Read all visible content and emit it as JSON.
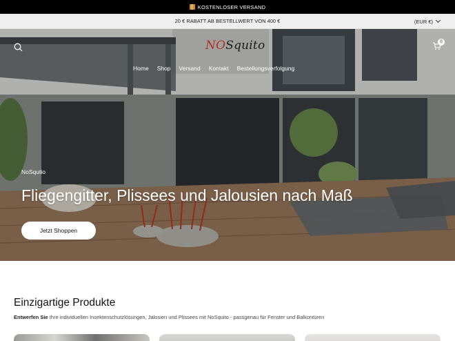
{
  "announcement": {
    "text": "KOSTENLOSER VERSAND",
    "icon": "gift-icon"
  },
  "promo": {
    "text": "20 € RABATT AB BESTELLWERT VON 400 €",
    "currency": "(EUR €)"
  },
  "header": {
    "logo_part1": "NO",
    "logo_part2": "Squito",
    "cart_count": "0",
    "nav": [
      "Home",
      "Shop",
      "Versand",
      "Kontakt",
      "Bestellungsverfolgung"
    ]
  },
  "hero": {
    "eyebrow": "NoSqutio",
    "title": "Fliegengitter, Plissees und Jalousien nach Maß",
    "button": "Jetzt Shoppen"
  },
  "products": {
    "heading": "Einzigartige Produkte",
    "sub_bold": "Entwerfen Sie",
    "sub_rest": " Ihre individuellen Insektenschutzlösungen, Jalosien und Plissees mit NoSquito - passgenau für Fenster und Balkontüren"
  },
  "colors": {
    "accent": "#b03024",
    "topbar": "#000000",
    "promo_bg": "#efefef"
  }
}
